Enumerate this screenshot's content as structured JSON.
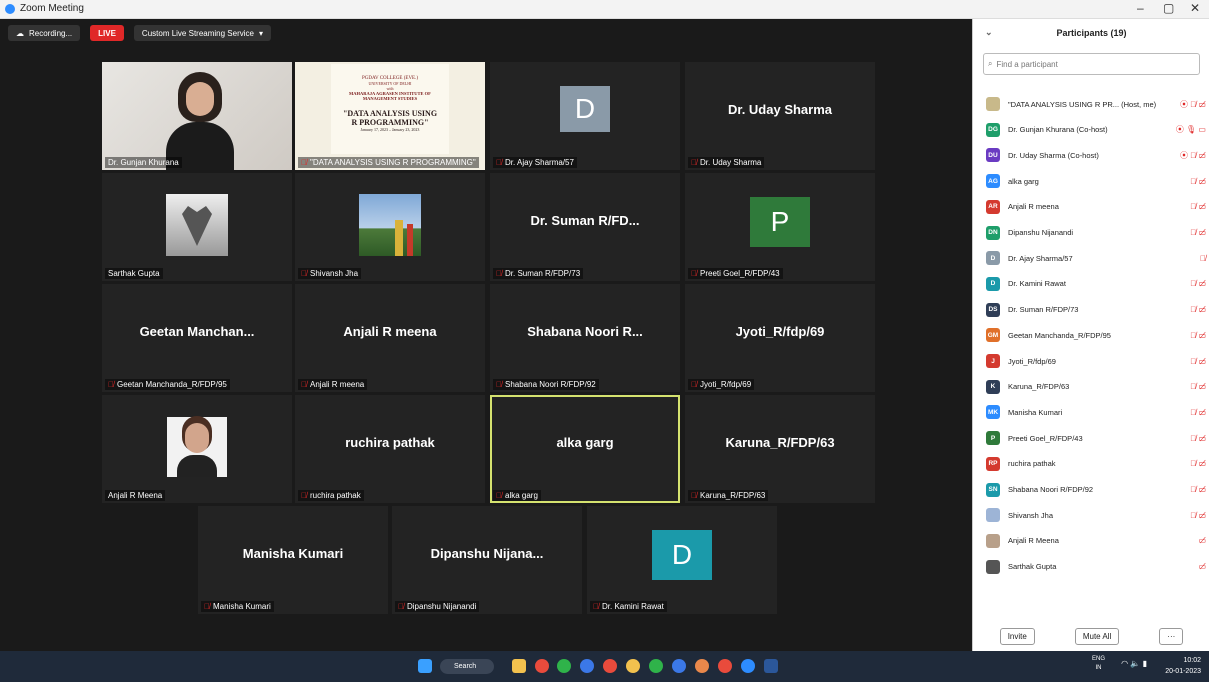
{
  "window": {
    "title": "Zoom Meeting",
    "minimize": "–",
    "restore": "▢",
    "close": "✕"
  },
  "toolbar": {
    "recording": "Recording...",
    "live": "LIVE",
    "streaming": "Custom Live Streaming Service",
    "streaming_arrow": "▾"
  },
  "tiles": {
    "t1": {
      "name": "",
      "label": "Dr. Gunjan Khurana",
      "muted": false
    },
    "t2": {
      "label": "\"DATA ANALYSIS USING R PROGRAMMING\"",
      "muted": true,
      "slide": {
        "college": "PGDAV COLLEGE (EVE.)",
        "univ": "UNIVERSITY OF DELHI",
        "with": "with",
        "institute": "MAHARAJA AGRASEN INSTITUTE OF",
        "inst2": "MANAGEMENT STUDIES",
        "title": "\"DATA ANALYSIS USING",
        "title2": "R PROGRAMMING\"",
        "dates": "January 17, 2023 – January 23, 2023"
      }
    },
    "t3": {
      "avatar": "D",
      "label": "Dr. Ajay Sharma/57",
      "muted": true
    },
    "t4": {
      "name": "Dr. Uday Sharma",
      "label": "Dr. Uday Sharma",
      "muted": true
    },
    "t5": {
      "label": "Sarthak Gupta",
      "muted": false
    },
    "t6": {
      "label": "Shivansh Jha",
      "muted": true
    },
    "t7": {
      "name": "Dr. Suman R/FD...",
      "label": "Dr. Suman R/FDP/73",
      "muted": true
    },
    "t8": {
      "avatar": "P",
      "label": "Preeti Goel_R/FDP/43",
      "muted": true
    },
    "t9": {
      "name": "Geetan Manchan...",
      "label": "Geetan Manchanda_R/FDP/95",
      "muted": true
    },
    "t10": {
      "name": "Anjali R meena",
      "label": "Anjali R meena",
      "muted": true
    },
    "t11": {
      "name": "Shabana Noori R...",
      "label": "Shabana Noori R/FDP/92",
      "muted": true
    },
    "t12": {
      "name": "Jyoti_R/fdp/69",
      "label": "Jyoti_R/fdp/69",
      "muted": true
    },
    "t13": {
      "label": "Anjali R Meena",
      "muted": false
    },
    "t14": {
      "name": "ruchira pathak",
      "label": "ruchira pathak",
      "muted": true
    },
    "t15": {
      "name": "alka garg",
      "label": "alka garg",
      "muted": true
    },
    "t16": {
      "name": "Karuna_R/FDP/63",
      "label": "Karuna_R/FDP/63",
      "muted": true
    },
    "t17": {
      "name": "Manisha Kumari",
      "label": "Manisha Kumari",
      "muted": true
    },
    "t18": {
      "name": "Dipanshu  Nijana...",
      "label": "Dipanshu Nijanandi",
      "muted": true
    },
    "t19": {
      "avatar": "D",
      "label": "Dr. Kamini Rawat",
      "muted": true
    }
  },
  "panel": {
    "title": "Participants (19)",
    "chevron": "⌄",
    "search_placeholder": "Find a participant",
    "participants": [
      {
        "initials": "",
        "color": "#c8b98a",
        "name": "\"DATA ANALYSIS USING R PR... (Host, me)",
        "icons": "⦿ 🎙̸ ▭̸"
      },
      {
        "initials": "DG",
        "color": "#1e9e6a",
        "name": "Dr. Gunjan Khurana (Co-host)",
        "icons": "⦿ 🎙 ▭"
      },
      {
        "initials": "DU",
        "color": "#6a3bc2",
        "name": "Dr. Uday Sharma (Co-host)",
        "icons": "⦿ 🎙̸ ▭̸"
      },
      {
        "initials": "AG",
        "color": "#2d8cff",
        "name": "alka garg",
        "icons": "🎙̸ ▭̸"
      },
      {
        "initials": "AR",
        "color": "#d43a2f",
        "name": "Anjali R meena",
        "icons": "🎙̸ ▭̸"
      },
      {
        "initials": "DN",
        "color": "#1e9e6a",
        "name": "Dipanshu Nijanandi",
        "icons": "🎙̸ ▭̸"
      },
      {
        "initials": "D",
        "color": "#8a9aa8",
        "name": "Dr. Ajay Sharma/57",
        "icons": "🎙̸"
      },
      {
        "initials": "D",
        "color": "#1b9aaa",
        "name": "Dr. Kamini Rawat",
        "icons": "🎙̸ ▭̸"
      },
      {
        "initials": "DS",
        "color": "#2f3e57",
        "name": "Dr. Suman R/FDP/73",
        "icons": "🎙̸ ▭̸"
      },
      {
        "initials": "GM",
        "color": "#e0702a",
        "name": "Geetan Manchanda_R/FDP/95",
        "icons": "🎙̸ ▭̸"
      },
      {
        "initials": "J",
        "color": "#d43a2f",
        "name": "Jyoti_R/fdp/69",
        "icons": "🎙̸ ▭̸"
      },
      {
        "initials": "K",
        "color": "#2f3e57",
        "name": "Karuna_R/FDP/63",
        "icons": "🎙̸ ▭̸"
      },
      {
        "initials": "MK",
        "color": "#2d8cff",
        "name": "Manisha Kumari",
        "icons": "🎙̸ ▭̸"
      },
      {
        "initials": "P",
        "color": "#2f7a3a",
        "name": "Preeti Goel_R/FDP/43",
        "icons": "🎙̸ ▭̸"
      },
      {
        "initials": "RP",
        "color": "#d43a2f",
        "name": "ruchira pathak",
        "icons": "🎙̸ ▭̸"
      },
      {
        "initials": "SN",
        "color": "#1b9aaa",
        "name": "Shabana Noori R/FDP/92",
        "icons": "🎙̸ ▭̸"
      },
      {
        "initials": "",
        "color": "#9db4d6",
        "name": "Shivansh Jha",
        "icons": "🎙̸ ▭̸"
      },
      {
        "initials": "",
        "color": "#b8a08a",
        "name": "Anjali R Meena",
        "icons": "▭̸"
      },
      {
        "initials": "",
        "color": "#555555",
        "name": "Sarthak Gupta",
        "icons": "▭̸"
      }
    ],
    "invite": "Invite",
    "mute_all": "Mute All",
    "more": "···"
  },
  "taskbar": {
    "search": "Search",
    "lang1": "ENG",
    "lang2": "IN",
    "time": "10:02",
    "date": "20-01-2023"
  }
}
